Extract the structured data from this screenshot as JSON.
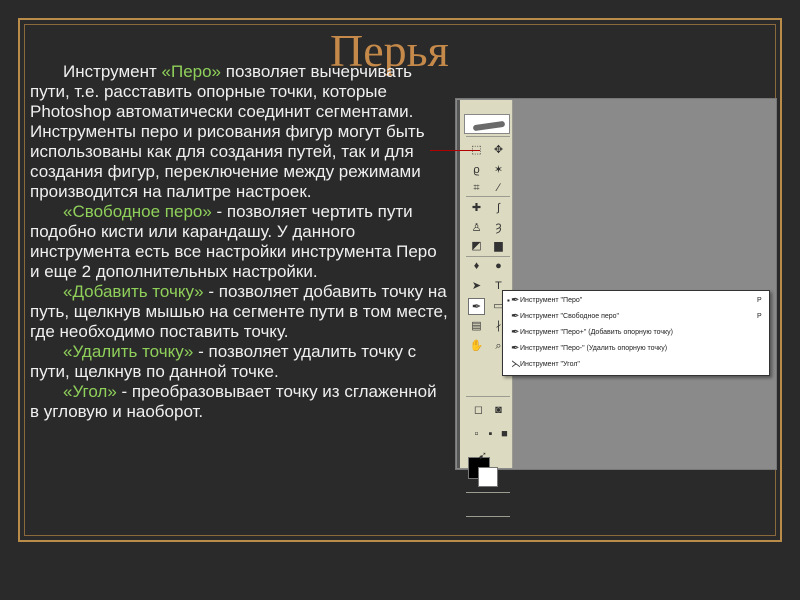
{
  "slide": {
    "title": "Перья",
    "paragraphs": [
      [
        {
          "text": "Инструмент ",
          "hl": false
        },
        {
          "text": "«Перо»",
          "hl": true
        },
        {
          "text": " позволяет вычерчивать пути, т.е. расставить опорные точки, которые Photoshop автоматически соединит сегментами. Инструменты перо и рисования фигур могут быть использованы как для создания путей, так и для создания фигур, переключение между режимами производится на палитре настроек.",
          "hl": false
        }
      ],
      [
        {
          "text": "«Свободное перо»",
          "hl": true
        },
        {
          "text": " - позволяет чертить пути подобно кисти или карандашу. У данного инструмента есть все настройки инструмента Перо и еще 2 дополнительных настройки.",
          "hl": false
        }
      ],
      [
        {
          "text": "«Добавить точку»",
          "hl": true
        },
        {
          "text": " - позволяет добавить точку на путь, щелкнув мышью на сегменте пути в том месте, где необходимо поставить точку.",
          "hl": false
        }
      ],
      [
        {
          "text": "«Удалить точку»",
          "hl": true
        },
        {
          "text": " - позволяет удалить точку с пути, щелкнув по данной точке.",
          "hl": false
        }
      ],
      [
        {
          "text": "«Угол»",
          "hl": true
        },
        {
          "text": " - преобразовывает точку из сглаженной в угловую и наоборот.",
          "hl": false
        }
      ]
    ]
  },
  "colors": {
    "title": "#c5894a",
    "highlight": "#8fd05a",
    "body_text": "#f0f0f0",
    "background": "#2a2a2a",
    "frame": "#b98c4a"
  },
  "toolbox": {
    "tools": [
      {
        "icon": "marquee-icon",
        "glyph": "⬚"
      },
      {
        "icon": "move-icon",
        "glyph": "✥"
      },
      {
        "icon": "lasso-icon",
        "glyph": "ϱ"
      },
      {
        "icon": "magic-wand-icon",
        "glyph": "✶"
      },
      {
        "icon": "crop-icon",
        "glyph": "⌗"
      },
      {
        "icon": "slice-icon",
        "glyph": "∕"
      },
      {
        "icon": "healing-brush-icon",
        "glyph": "✚"
      },
      {
        "icon": "brush-icon",
        "glyph": "∫"
      },
      {
        "icon": "clone-stamp-icon",
        "glyph": "♙"
      },
      {
        "icon": "history-brush-icon",
        "glyph": "Ȝ"
      },
      {
        "icon": "eraser-icon",
        "glyph": "◩"
      },
      {
        "icon": "gradient-icon",
        "glyph": "▆"
      },
      {
        "icon": "blur-icon",
        "glyph": "♦"
      },
      {
        "icon": "dodge-icon",
        "glyph": "●"
      },
      {
        "icon": "path-select-icon",
        "glyph": "➤"
      },
      {
        "icon": "type-icon",
        "glyph": "T"
      },
      {
        "icon": "pen-icon",
        "glyph": "✒"
      },
      {
        "icon": "shape-icon",
        "glyph": "▭"
      },
      {
        "icon": "notes-icon",
        "glyph": "▤"
      },
      {
        "icon": "eyedropper-icon",
        "glyph": "∤"
      },
      {
        "icon": "hand-icon",
        "glyph": "✋"
      },
      {
        "icon": "zoom-icon",
        "glyph": "⌕"
      },
      {
        "icon": "standard-mode-icon",
        "glyph": "◻"
      },
      {
        "icon": "quickmask-mode-icon",
        "glyph": "◙"
      },
      {
        "icon": "screen-mode-1-icon",
        "glyph": "▫"
      },
      {
        "icon": "screen-mode-2-icon",
        "glyph": "▪"
      },
      {
        "icon": "screen-mode-3-icon",
        "glyph": "■"
      },
      {
        "icon": "jump-to-imageready-icon",
        "glyph": "➹"
      }
    ]
  },
  "pen_menu": {
    "items": [
      {
        "label": "Инструмент \"Перо\"",
        "shortcut": "P",
        "selected": true
      },
      {
        "label": "Инструмент \"Свободное перо\"",
        "shortcut": "P",
        "selected": false
      },
      {
        "label": "Инструмент \"Перо+\" (Добавить опорную точку)",
        "shortcut": "",
        "selected": false
      },
      {
        "label": "Инструмент \"Перо-\" (Удалить опорную точку)",
        "shortcut": "",
        "selected": false
      },
      {
        "label": "Инструмент \"Угол\"",
        "shortcut": "",
        "selected": false
      }
    ]
  }
}
